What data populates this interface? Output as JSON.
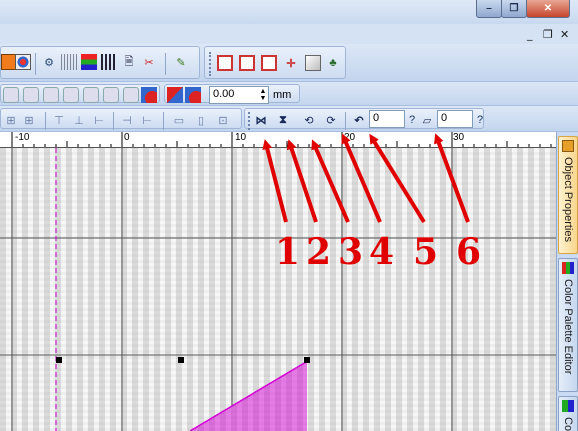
{
  "window": {
    "minimize_glyph": "–",
    "restore_glyph": "❐",
    "close_glyph": "✕"
  },
  "mdi_controls": {
    "minimize": "_",
    "restore": "❐",
    "close": "✕"
  },
  "toolbar_row2": {
    "value": "0.00",
    "unit": "mm"
  },
  "toolbar_row3": {
    "rotate_value": "0",
    "rotate_help": "?",
    "slant_value": "0",
    "slant_help": "?"
  },
  "ruler": {
    "labels": [
      "-10",
      "0",
      "10",
      "20",
      "30"
    ]
  },
  "dock": {
    "tabs": [
      "Object Properties",
      "Color Palette Editor",
      "Co"
    ]
  },
  "annotations": {
    "numbers": [
      "1",
      "2",
      "3",
      "4",
      "5",
      "6"
    ],
    "color": "#e00000"
  },
  "colors": {
    "guide": "#cc00cc",
    "stitch": "#d400d4",
    "grid": "#555555"
  }
}
